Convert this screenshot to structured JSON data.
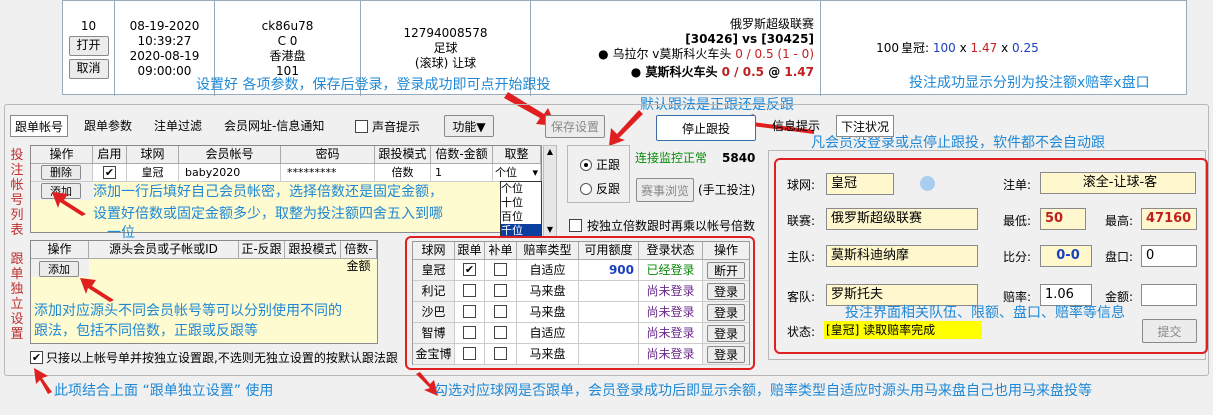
{
  "top": {
    "id": "10",
    "open": "打开",
    "cancel": "取消",
    "date1": "08-19-2020",
    "time1": "10:39:27",
    "date2": "2020-08-19",
    "time2": "09:00:00",
    "user": "ck86u78",
    "c0": "C 0",
    "pan": "香港盘",
    "num": "101",
    "order": "12794008578",
    "sport": "足球",
    "type": "(滚球) 让球",
    "league": "俄罗斯超级联赛",
    "teams": "[30426] vs [30425]",
    "match_line": "乌拉尔 v莫斯科火车头",
    "match_odds": "0 / 0.5 (1 - 0)",
    "pick": "莫斯科火车头",
    "pick_odds_hcp": "0 / 0.5",
    "pick_at": "@",
    "pick_odds": "1.47",
    "amount": "100",
    "site": "皇冠:",
    "calc_a": "100",
    "calc_x": "x",
    "calc_b": "1.47",
    "calc_c": "0.25"
  },
  "annotations": {
    "a1": "设置好 各项参数，保存后登录，登录成功即可点开始跟投",
    "a2": "投注成功显示分别为投注额x赔率x盘口",
    "a3": "默认跟法是正跟还是反跟",
    "a4": "凡会员没登录或点停止跟投，软件都不会自动跟",
    "a5": "添加一行后填好自己会员帐密，选择倍数还是固定金额，",
    "a6": "设置好倍数或固定金额多少，取整为投注额四舍五入到哪",
    "a7": "一位",
    "a8": "添加对应源头不同会员帐号等可以分别使用不同的",
    "a9": "跟法，包括不同倍数，正跟或反跟等",
    "a10": "投注界面相关队伍、限额、盘口、赔率等信息",
    "a11": "此项结合上面 “跟单独立设置” 使用",
    "a12": "勾选对应球网是否跟单，会员登录成功后即显示余额，赔率类型自适应时源头用马来盘自己也用马来盘投等"
  },
  "tabs": [
    "跟单帐号",
    "跟单参数",
    "注单过滤",
    "会员网址-信息通知"
  ],
  "sound": "声音提示",
  "func": "功能▼",
  "save": "保存设置",
  "stop": "停止跟投",
  "info": "信息提示",
  "status_tab": "下注状况",
  "vlabel1": "投注帐号列表",
  "vlabel2": "跟单独立设置",
  "acct_table": {
    "headers": [
      "操作",
      "启用",
      "球网",
      "会员帐号",
      "密码",
      "跟投模式",
      "倍数-金额",
      "取整"
    ],
    "row": {
      "del": "删除",
      "site": "皇冠",
      "user": "baby2020",
      "pwd": "*********",
      "mode": "倍数",
      "mult": "1",
      "round": "个位"
    },
    "add": "添加",
    "options": [
      "个位",
      "十位",
      "百位",
      "千位"
    ]
  },
  "indep_table": {
    "headers": [
      "操作",
      "源头会员或子帐或ID",
      "正-反跟",
      "跟投模式",
      "倍数-金额"
    ],
    "add": "添加"
  },
  "radio_pos": "正跟",
  "radio_neg": "反跟",
  "conn": "连接监控正常",
  "conn_num": "5840",
  "browse": "赛事浏览",
  "manual": "(手工投注)",
  "mult_check": "按独立倍数跟时再乘以帐号倍数",
  "only_check": "只接以上帐号单并按独立设置跟,不选则无独立设置的按默认跟法跟",
  "sites": {
    "headers": [
      "球网",
      "跟单",
      "补单",
      "赔率类型",
      "可用额度",
      "登录状态",
      "操作"
    ],
    "rows": [
      {
        "name": "皇冠",
        "follow": true,
        "odds": "自适应",
        "credit": "900",
        "status": "已经登录",
        "op": "断开"
      },
      {
        "name": "利记",
        "follow": false,
        "odds": "马来盘",
        "credit": "",
        "status": "尚未登录",
        "op": "登录"
      },
      {
        "name": "沙巴",
        "follow": false,
        "odds": "马来盘",
        "credit": "",
        "status": "尚未登录",
        "op": "登录"
      },
      {
        "name": "智博",
        "follow": false,
        "odds": "自适应",
        "credit": "",
        "status": "尚未登录",
        "op": "登录"
      },
      {
        "name": "金宝博",
        "follow": false,
        "odds": "马来盘",
        "credit": "",
        "status": "尚未登录",
        "op": "登录"
      }
    ]
  },
  "bet": {
    "site_l": "球网:",
    "site": "皇冠",
    "note_l": "注单:",
    "note": "滚全-让球-客",
    "league_l": "联赛:",
    "league": "俄罗斯超级联赛",
    "min_l": "最低:",
    "min": "50",
    "max_l": "最高:",
    "max": "47160",
    "home_l": "主队:",
    "home": "莫斯科迪纳摩",
    "score_l": "比分:",
    "score": "0-0",
    "hcp_l": "盘口:",
    "hcp": "0",
    "away_l": "客队:",
    "away": "罗斯托夫",
    "odds_l": "赔率:",
    "odds": "1.06",
    "amt_l": "金额:",
    "amt": "",
    "status_l": "状态:",
    "status": "[皇冠] 读取赔率完成",
    "submit": "提交"
  },
  "colors": {
    "annotation": "#1e88d6",
    "red": "#e02020",
    "green": "#0a8a0a",
    "purple": "#6a2a8a"
  }
}
